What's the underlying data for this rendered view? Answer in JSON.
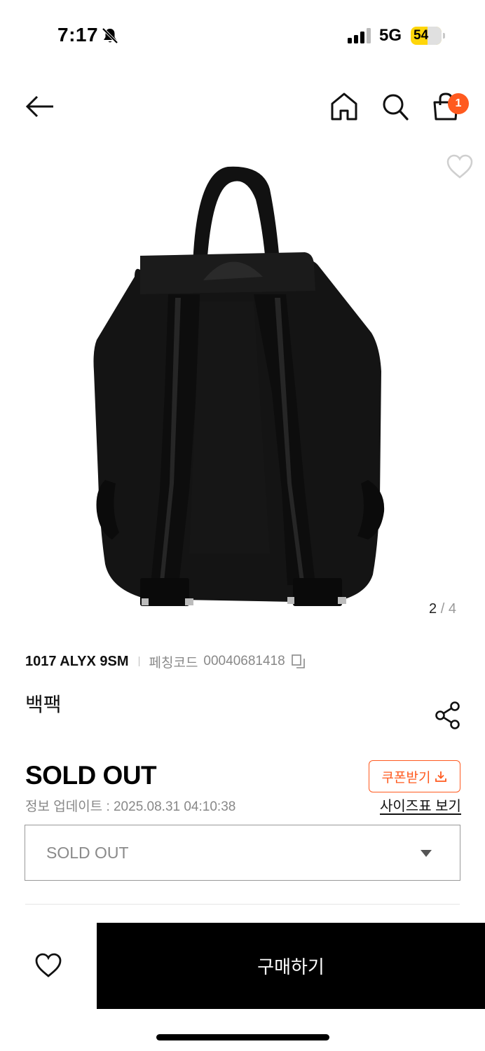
{
  "status_bar": {
    "time": "7:17",
    "network": "5G",
    "battery_level": "54",
    "battery_fraction": 0.54
  },
  "header": {
    "cart_count": "1",
    "icons": [
      "back-arrow-icon",
      "home-icon",
      "search-icon",
      "shopping-bag-icon"
    ]
  },
  "gallery": {
    "current_page": "2",
    "separator": "/",
    "total_pages": "4"
  },
  "product": {
    "brand": "1017 ALYX 9SM",
    "code_label": "페칭코드",
    "code_value": "00040681418",
    "name": "백팩",
    "price": "SOLD OUT",
    "update_text": "정보 업데이트 : 2025.08.31 04:10:38"
  },
  "actions": {
    "coupon_label": "쿠폰받기",
    "size_chart_label": "사이즈표 보기",
    "option_value": "SOLD OUT",
    "buy_label": "구매하기"
  },
  "colors": {
    "accent": "#ff5a1f",
    "buy_button": "#000000",
    "battery": "#ffd60a"
  }
}
